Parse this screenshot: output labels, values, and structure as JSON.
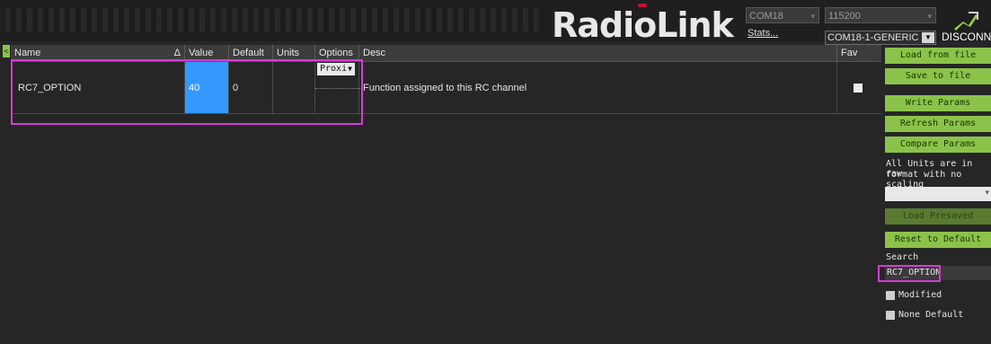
{
  "header": {
    "logo_text": "RadioLink",
    "port": "COM18",
    "baud": "115200",
    "stats_label": "Stats...",
    "board": "COM18-1-GENERIC",
    "disconnect_label": "DISCONNECT"
  },
  "grid": {
    "columns": [
      "Name",
      "Value",
      "Default",
      "Units",
      "Options",
      "Desc",
      "Fav"
    ],
    "sort_indicator": "Δ",
    "rows": [
      {
        "name": "RC7_OPTION",
        "value": "40",
        "default": "0",
        "units": "",
        "option": "Proxi",
        "desc": "Function assigned to this RC channel",
        "fav": false
      }
    ]
  },
  "sidebar": {
    "load_file": "Load from file",
    "save_file": "Save to file",
    "write_params": "Write Params",
    "refresh_params": "Refresh Params",
    "compare_params": "Compare Params",
    "units_note_1": "All Units are in raw",
    "units_note_2": "format with no scaling",
    "load_presaved": "Load Presaved",
    "reset_default": "Reset to Default",
    "search_label": "Search",
    "search_value": "RC7_OPTION",
    "modified_label": "Modified",
    "none_default_label": "None Default"
  },
  "colors": {
    "accent_green": "#8bc34a",
    "highlight": "#d63ad8",
    "selection": "#3399ff"
  }
}
